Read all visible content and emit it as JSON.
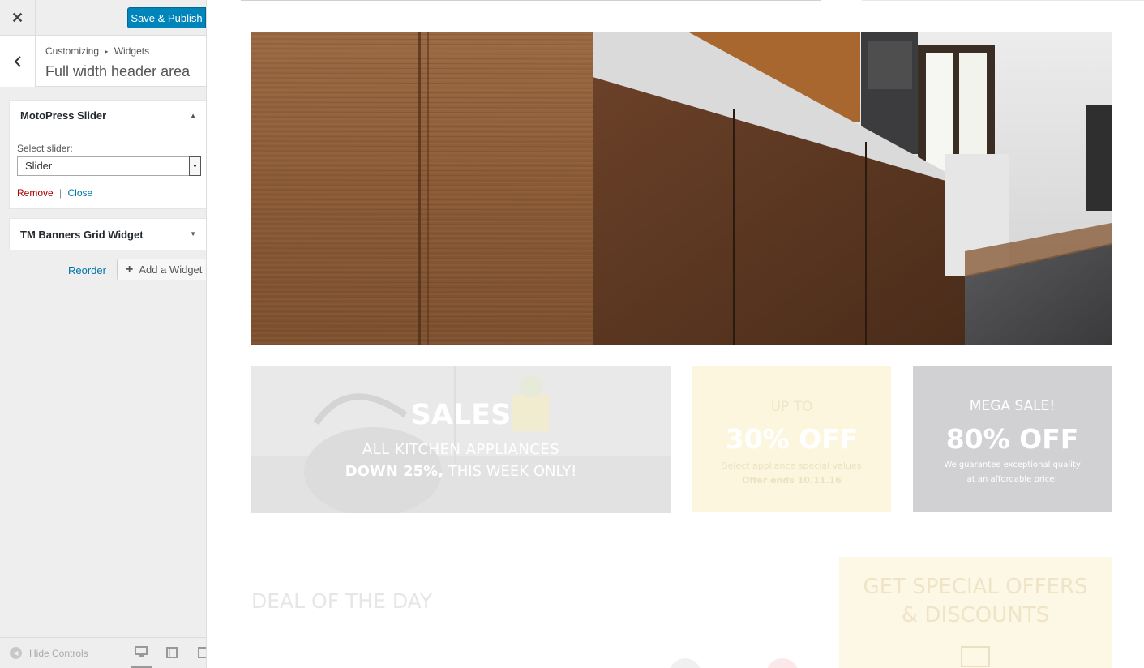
{
  "sidebar": {
    "close_icon": "close-icon",
    "publish_label": "Save & Publish",
    "breadcrumb": {
      "parent": "Customizing",
      "current": "Widgets"
    },
    "section_title": "Full width header area",
    "widgets": [
      {
        "title": "MotoPress Slider",
        "expanded": true,
        "select_label": "Select slider:",
        "select_value": "Slider",
        "remove_label": "Remove",
        "separator": "|",
        "close_label": "Close"
      },
      {
        "title": "TM Banners Grid Widget",
        "expanded": false
      }
    ],
    "reorder_label": "Reorder",
    "add_widget_label": "Add a Widget",
    "hide_controls_label": "Hide Controls",
    "devices": [
      "desktop",
      "tablet",
      "mobile"
    ]
  },
  "preview": {
    "banners": [
      {
        "title": "SALES",
        "line1": "ALL KITCHEN APPLIANCES",
        "line2_bold": "DOWN 25%,",
        "line2_rest": " THIS WEEK ONLY!"
      },
      {
        "pre": "UP TO",
        "headline": "30% OFF",
        "line1": "Select appliance special values",
        "line2": "Offer ends 10.11.16"
      },
      {
        "pre": "MEGA SALE!",
        "headline": "80% OFF",
        "line1": "We guarantee exceptional quality",
        "line2": "at an affordable price!"
      }
    ],
    "deal_title": "DEAL OF THE DAY",
    "offers": {
      "line1": "GET SPECIAL OFFERS",
      "line2": "& DISCOUNTS"
    }
  },
  "colors": {
    "primary": "#0085ba",
    "link": "#0073aa",
    "remove": "#a00000",
    "sidebar_bg": "#eeeeee"
  }
}
